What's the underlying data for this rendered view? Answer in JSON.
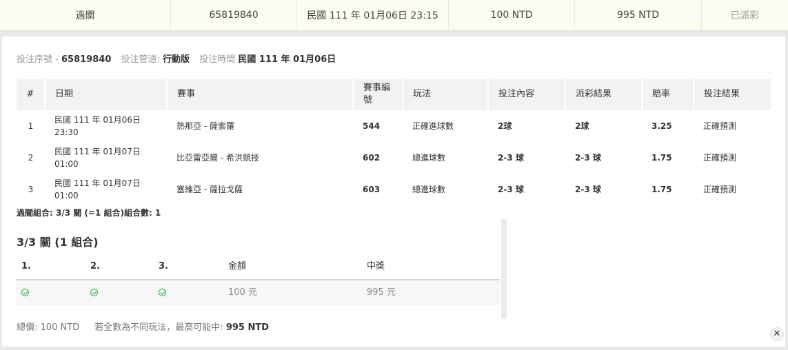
{
  "summary": {
    "type": "過關",
    "ticket_no": "65819840",
    "bet_time": "民國 111 年 01月06日 23:15",
    "stake": "100 NTD",
    "payout": "995 NTD",
    "status": "已派彩"
  },
  "meta": {
    "serial_label": "投注序號",
    "serial_sep": "-",
    "serial_value": "65819840",
    "channel_label": "投注管道:",
    "channel_value": "行動版",
    "time_label": "投注時間",
    "time_value": "民國 111 年 01月06日"
  },
  "table": {
    "headers": [
      "#",
      "日期",
      "賽事",
      "賽事編號",
      "玩法",
      "投注內容",
      "派彩結果",
      "賠率",
      "投注結果"
    ],
    "rows": [
      {
        "num": "1",
        "date": "民國 111 年 01月06日",
        "time": "23:30",
        "match": "熱那亞 - 薩索羅",
        "event_id": "544",
        "play": "正確進球數",
        "bet": "2球",
        "result": "2球",
        "odds": "3.25",
        "outcome": "正確預測"
      },
      {
        "num": "2",
        "date": "民國 111 年 01月07日",
        "time": "01:00",
        "match": "比亞雷亞爾 - 希洪競技",
        "event_id": "602",
        "play": "總進球數",
        "bet": "2-3 球",
        "result": "2-3 球",
        "odds": "1.75",
        "outcome": "正確預測"
      },
      {
        "num": "3",
        "date": "民國 111 年 01月07日",
        "time": "01:00",
        "match": "塞維亞 - 薩拉戈薩",
        "event_id": "603",
        "play": "總進球數",
        "bet": "2-3 球",
        "result": "2-3 球",
        "odds": "1.75",
        "outcome": "正確預測"
      }
    ]
  },
  "combo": {
    "note": "過關組合: 3/3 關 (=1 組合)組合數: 1",
    "title": "3/3 關 (1 組合)",
    "headers": [
      "1.",
      "2.",
      "3.",
      "金額",
      "中獎"
    ],
    "row": {
      "amount": "100 元",
      "win": "995 元"
    }
  },
  "total": {
    "price_label": "總價:",
    "price_value": "100 NTD",
    "max_label": "若全數為不同玩法，最高可能中:",
    "max_value": "995 NTD"
  },
  "close_label": "✕",
  "colors": {
    "check": "#2eaa4f",
    "summary_bg": "#fdfcf0",
    "header_bg": "#f2f2f2"
  },
  "icons": {
    "leg_status": "check-circle-icon",
    "close": "close-icon"
  }
}
